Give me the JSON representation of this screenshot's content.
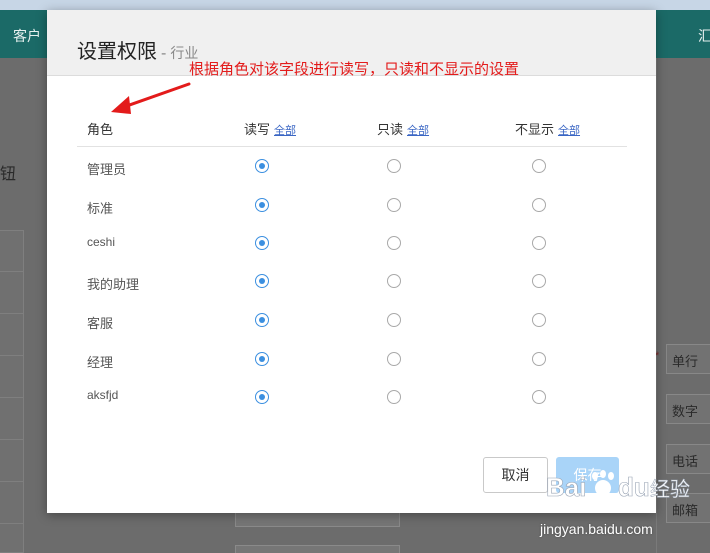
{
  "background": {
    "header_tabs": [
      "客户",
      "汇"
    ],
    "left_glyph": "钮",
    "right_fields": [
      "单行",
      "数字",
      "电话",
      "邮箱"
    ],
    "required_mark": "*"
  },
  "dialog": {
    "title": "设置权限",
    "separator": "-",
    "subtitle": "行业",
    "annotation": "根据角色对该字段进行读写，只读和不显示的设置",
    "annotation_color": "#e31b1b",
    "columns": {
      "role": "角色",
      "read_write": "读写",
      "read_only": "只读",
      "hidden": "不显示",
      "all_link": "全部"
    },
    "roles": [
      {
        "name": "管理员",
        "selected": "read_write"
      },
      {
        "name": "标准",
        "selected": "read_write"
      },
      {
        "name": "ceshi",
        "selected": "read_write"
      },
      {
        "name": "我的助理",
        "selected": "read_write"
      },
      {
        "name": "客服",
        "selected": "read_write"
      },
      {
        "name": "经理",
        "selected": "read_write"
      },
      {
        "name": "aksfjd",
        "selected": "read_write"
      }
    ],
    "buttons": {
      "cancel": "取消",
      "save": "保存"
    },
    "accent_color": "#3b8fe0"
  },
  "watermark": {
    "brand": "Baidu经验",
    "url": "jingyan.baidu.com"
  }
}
